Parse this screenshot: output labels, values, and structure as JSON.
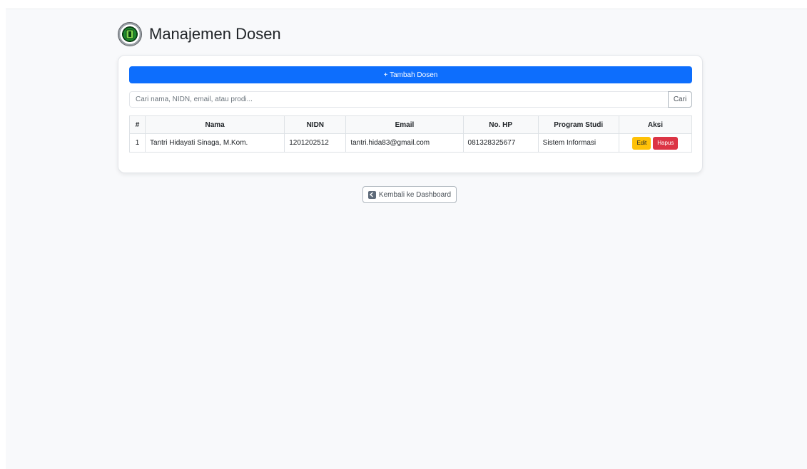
{
  "header": {
    "title": "Manajemen Dosen",
    "logo_icon": "university-seal-icon"
  },
  "toolbar": {
    "add_label": "+ Tambah Dosen"
  },
  "search": {
    "placeholder": "Cari nama, NIDN, email, atau prodi...",
    "button_label": "Cari"
  },
  "table": {
    "columns": [
      "#",
      "Nama",
      "NIDN",
      "Email",
      "No. HP",
      "Program Studi",
      "Aksi"
    ],
    "rows": [
      {
        "no": "1",
        "nama": "Tantri Hidayati Sinaga, M.Kom.",
        "nidn": "1201202512",
        "email": "tantri.hida83@gmail.com",
        "hp": "081328325677",
        "prodi": "Sistem Informasi",
        "edit_label": "Edit",
        "delete_label": "Hapus"
      }
    ]
  },
  "footer": {
    "back_label": "Kembali ke Dashboard",
    "back_icon": "arrow-left-square-icon"
  },
  "colors": {
    "primary": "#0d6efd",
    "warning": "#ffc107",
    "danger": "#dc3545",
    "background": "#f8f9fb"
  }
}
